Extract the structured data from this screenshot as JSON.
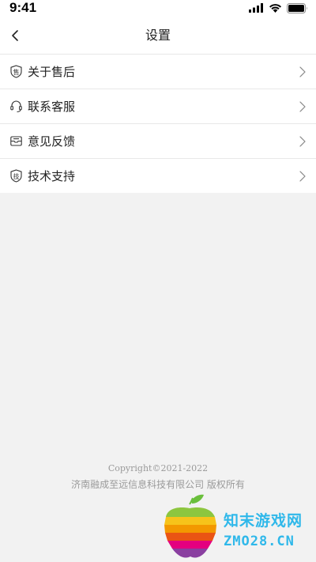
{
  "status_bar": {
    "time": "9:41"
  },
  "nav": {
    "title": "设置"
  },
  "menu": {
    "items": [
      {
        "label": "关于售后",
        "icon": "after-sales-shield-icon",
        "icon_glyph": "售"
      },
      {
        "label": "联系客服",
        "icon": "headset-icon"
      },
      {
        "label": "意见反馈",
        "icon": "feedback-envelope-icon"
      },
      {
        "label": "技术支持",
        "icon": "tech-support-shield-icon",
        "icon_glyph": "技"
      }
    ]
  },
  "footer": {
    "copyright": "Copyright©2021-2022",
    "company": "济南融成至远信息科技有限公司  版权所有"
  },
  "watermark": {
    "line1": "知末游戏网",
    "line2": "ZMO28.CN"
  },
  "colors": {
    "background": "#f2f2f2",
    "surface": "#ffffff",
    "divider": "#e8e8e8",
    "text": "#222222",
    "footer_text": "#9a9a9a",
    "watermark_blue": "#2fb8ea"
  }
}
